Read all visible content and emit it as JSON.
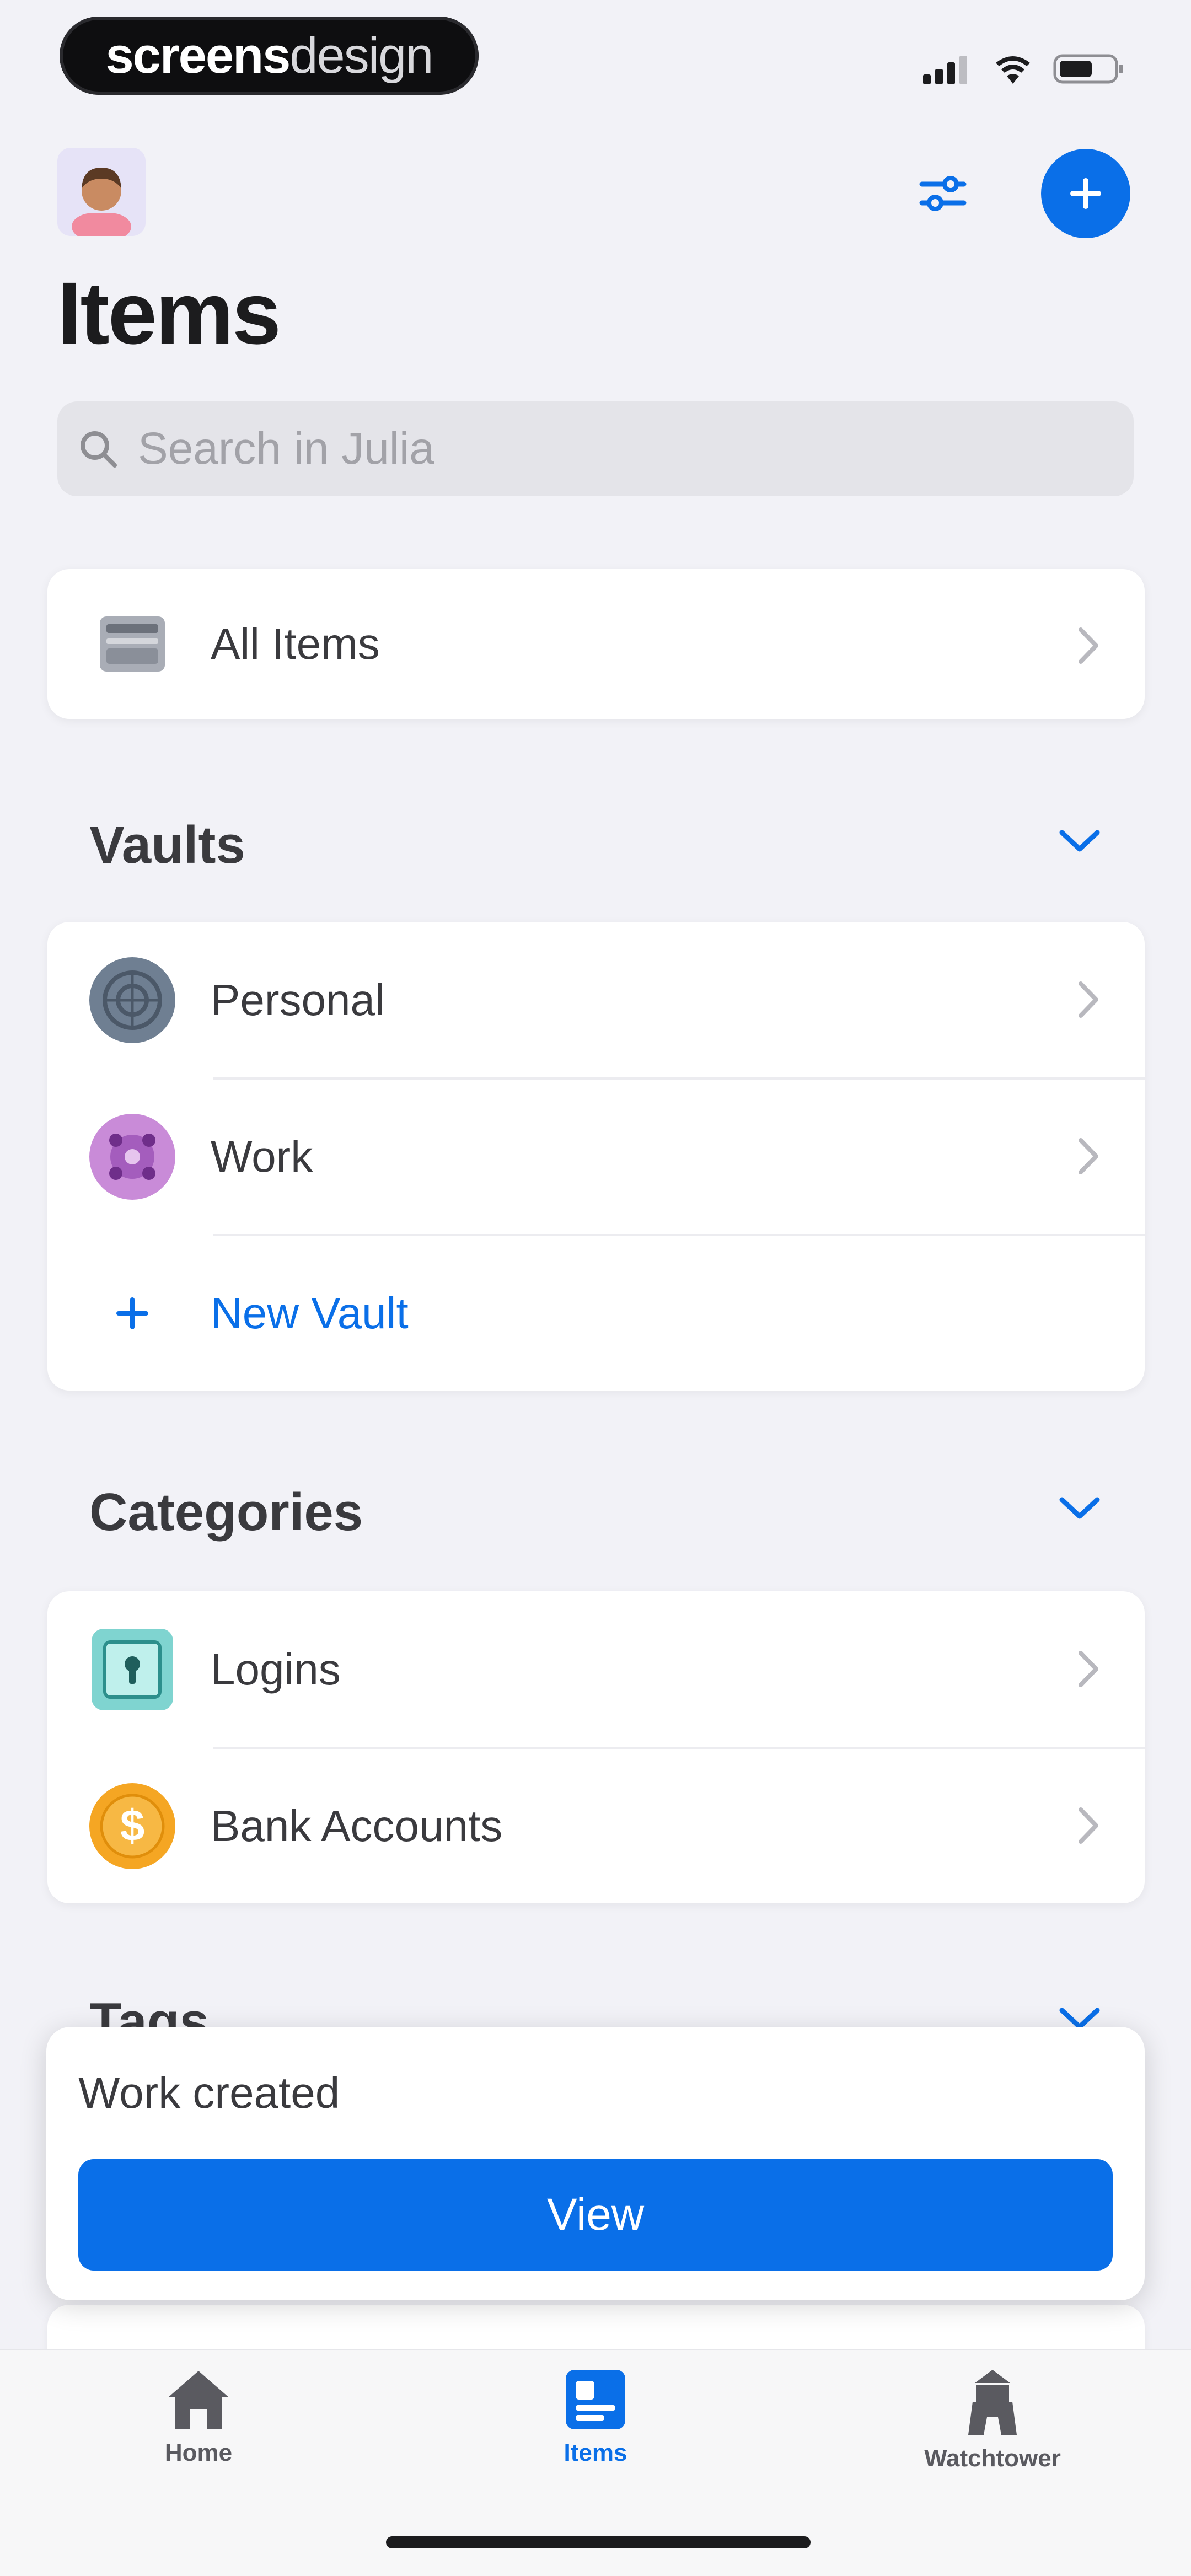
{
  "status_bar": {
    "watermark_bold": "screens",
    "watermark_light": "design"
  },
  "header": {
    "title": "Items"
  },
  "search": {
    "placeholder": "Search in Julia"
  },
  "all_items": {
    "label": "All Items"
  },
  "vaults": {
    "title": "Vaults",
    "items": [
      {
        "label": "Personal"
      },
      {
        "label": "Work"
      }
    ],
    "new_label": "New Vault"
  },
  "categories": {
    "title": "Categories",
    "items": [
      {
        "label": "Logins"
      },
      {
        "label": "Bank Accounts"
      }
    ]
  },
  "tags": {
    "title": "Tags"
  },
  "toast": {
    "message": "Work created",
    "button": "View"
  },
  "tabbar": {
    "home": "Home",
    "items": "Items",
    "watchtower": "Watchtower"
  },
  "colors": {
    "accent": "#0a6fe8",
    "background": "#f2f2f7",
    "login_icon": "#7fd4d0",
    "bank_icon": "#f5a623",
    "work_vault": "#b56cc9",
    "personal_vault": "#6f7f92"
  }
}
